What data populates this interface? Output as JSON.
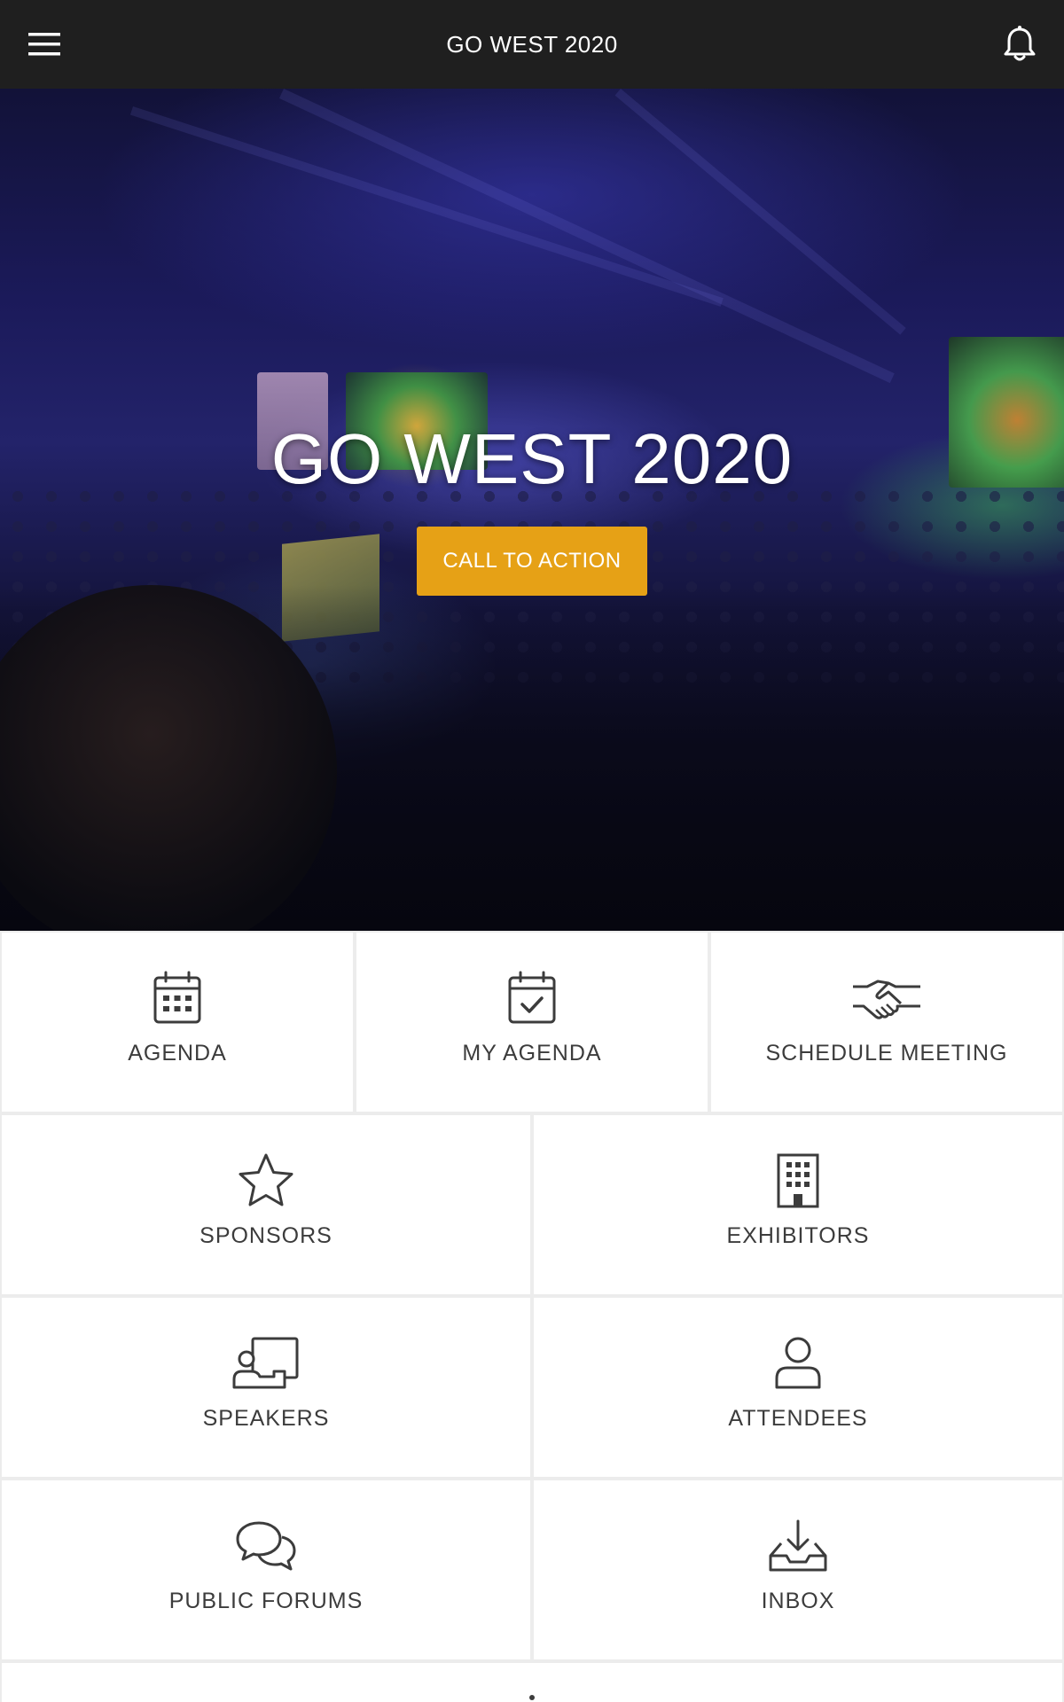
{
  "header": {
    "title": "GO WEST 2020",
    "menu_icon": "hamburger-menu-icon",
    "notification_icon": "bell-icon"
  },
  "hero": {
    "title": "GO WEST 2020",
    "cta_label": "CALL TO ACTION",
    "cta_color": "#e6a116"
  },
  "tiles": [
    {
      "label": "AGENDA",
      "icon": "calendar-icon"
    },
    {
      "label": "MY AGENDA",
      "icon": "calendar-check-icon"
    },
    {
      "label": "SCHEDULE MEETING",
      "icon": "handshake-icon"
    },
    {
      "label": "SPONSORS",
      "icon": "star-icon"
    },
    {
      "label": "EXHIBITORS",
      "icon": "building-icon"
    },
    {
      "label": "SPEAKERS",
      "icon": "presenter-icon"
    },
    {
      "label": "ATTENDEES",
      "icon": "person-icon"
    },
    {
      "label": "PUBLIC FORUMS",
      "icon": "chat-bubbles-icon"
    },
    {
      "label": "INBOX",
      "icon": "inbox-download-icon"
    }
  ]
}
